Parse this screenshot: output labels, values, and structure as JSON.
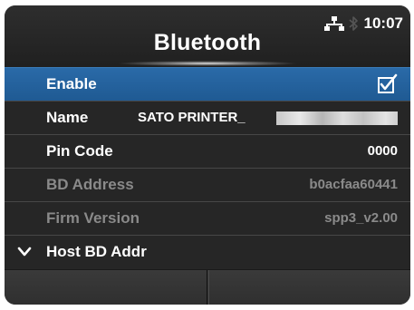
{
  "header": {
    "title": "Bluetooth",
    "time": "10:07",
    "icons": [
      "network-icon",
      "bluetooth-icon"
    ]
  },
  "rows": [
    {
      "label": "Enable",
      "value": "",
      "checked": true
    },
    {
      "label": "Name",
      "value": "SATO PRINTER_"
    },
    {
      "label": "Pin Code",
      "value": "0000"
    },
    {
      "label": "BD Address",
      "value": "b0acfaa60441"
    },
    {
      "label": "Firm Version",
      "value": "spp3_v2.00"
    },
    {
      "label": "Host BD Addr",
      "value": ""
    }
  ],
  "colors": {
    "background": "#262626",
    "selected": "#2263a0",
    "disabled_text": "#8a8a8a"
  }
}
